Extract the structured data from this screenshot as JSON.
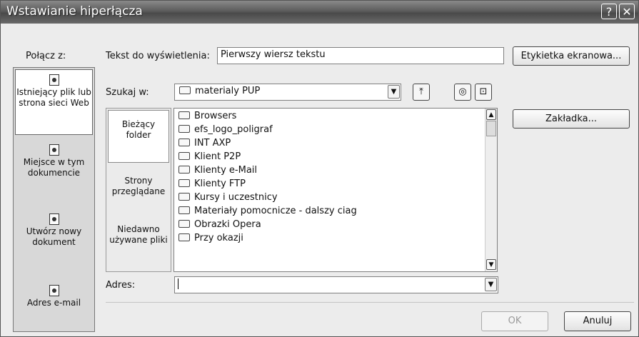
{
  "window": {
    "title": "Wstawianie hiperłącza",
    "help_label": "?",
    "close_label": "✕"
  },
  "link_to": {
    "label": "Połącz z:",
    "items": [
      {
        "icon": "existing-file-icon",
        "label": "Istniejący plik lub strona sieci Web"
      },
      {
        "icon": "place-in-document-icon",
        "label": "Miejsce w tym dokumencie"
      },
      {
        "icon": "new-document-icon",
        "label": "Utwórz nowy dokument"
      },
      {
        "icon": "email-address-icon",
        "label": "Adres e-mail"
      }
    ]
  },
  "text_to_display": {
    "label": "Tekst do wyświetlenia:",
    "value": "Pierwszy wiersz tekstu"
  },
  "screentip_button": "Etykietka ekranowa...",
  "look_in": {
    "label": "Szukaj w:",
    "value": "materialy PUP"
  },
  "nav": [
    {
      "label": "Bieżący folder"
    },
    {
      "label": "Strony przeglądane"
    },
    {
      "label": "Niedawno używane pliki"
    }
  ],
  "files": [
    "Browsers",
    "efs_logo_poligraf",
    "INT AXP",
    "Klient P2P",
    "Klienty e-Mail",
    "Klienty FTP",
    "Kursy i uczestnicy",
    "Materiały pomocnicze - dalszy ciag",
    "Obrazki Opera",
    "Przy okazji"
  ],
  "bookmark_button": "Zakładka...",
  "address": {
    "label": "Adres:",
    "value": ""
  },
  "ok_button": "OK",
  "cancel_button": "Anuluj"
}
